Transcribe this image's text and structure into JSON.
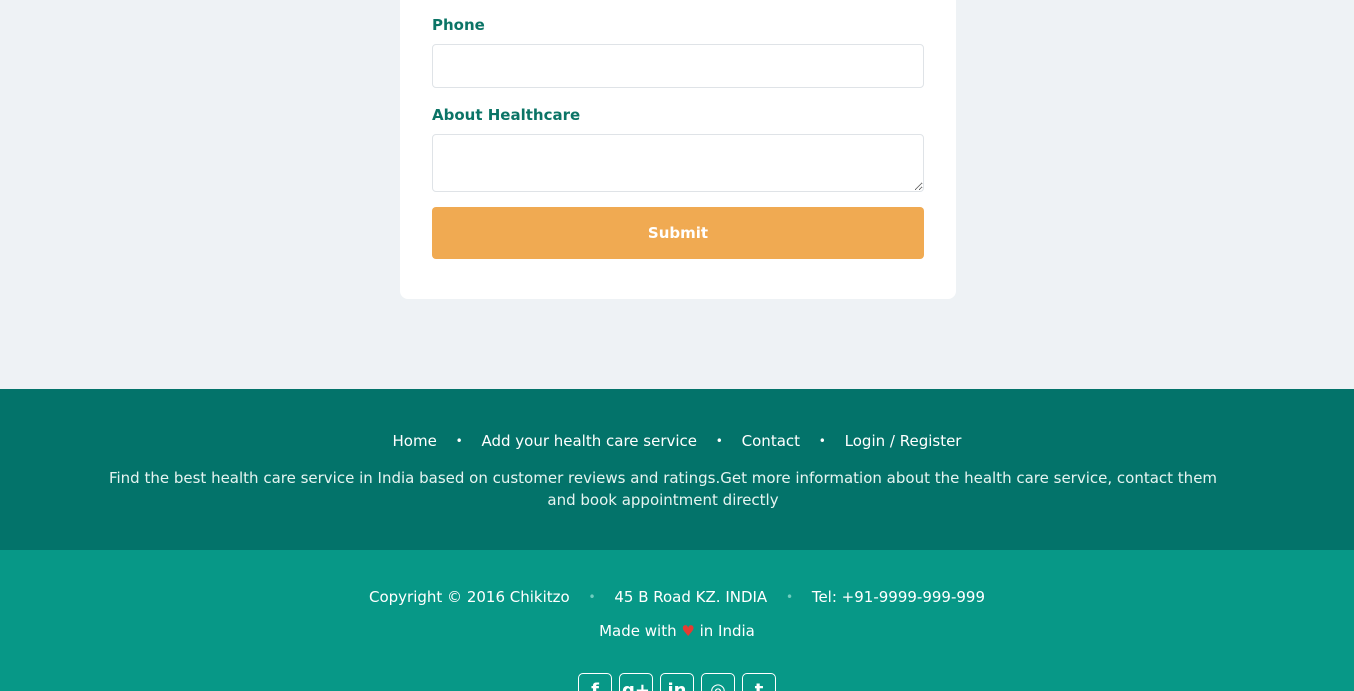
{
  "form": {
    "phone_label": "Phone",
    "phone_value": "",
    "about_label": "About Healthcare",
    "about_value": "",
    "submit_label": "Submit"
  },
  "footer_nav": {
    "items": [
      "Home",
      "Add your health care service",
      "Contact",
      "Login / Register"
    ],
    "separator": "•"
  },
  "footer_description": "Find the best health care service in India based on customer reviews and ratings.Get more information about the health care service, contact them and book appointment directly",
  "footer_info": {
    "copyright": "Copyright © 2016 Chikitzo",
    "address": "45 B Road KZ. INDIA",
    "phone": "Tel: +91-9999-999-999",
    "separator": "•",
    "made_with_prefix": "Made with",
    "heart": "♥",
    "made_with_suffix": "in India"
  },
  "socials": [
    {
      "icon": "facebook-icon",
      "glyph": "f"
    },
    {
      "icon": "google-plus-icon",
      "glyph": "g+"
    },
    {
      "icon": "linkedin-icon",
      "glyph": "in"
    },
    {
      "icon": "instagram-icon",
      "glyph": "◎"
    },
    {
      "icon": "tumblr-icon",
      "glyph": "t"
    }
  ],
  "colors": {
    "label": "#0b7466",
    "submit": "#f0aa52",
    "footer_top": "#03736a",
    "footer_bottom": "#079887",
    "heart": "#e53b32"
  }
}
